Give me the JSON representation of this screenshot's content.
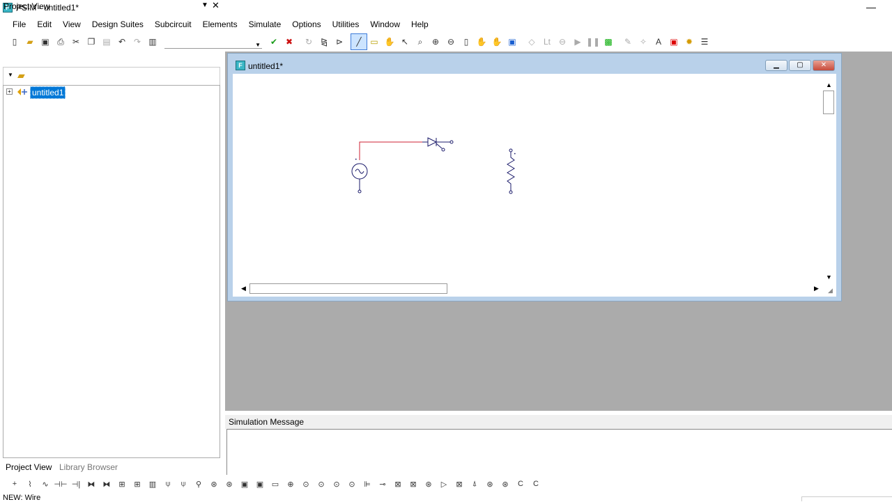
{
  "app": {
    "title": "PSIM - untitled1*",
    "icon_glyph": "F"
  },
  "menu": [
    "File",
    "Edit",
    "View",
    "Design Suites",
    "Subcircuit",
    "Elements",
    "Simulate",
    "Options",
    "Utilities",
    "Window",
    "Help"
  ],
  "project_view": {
    "title": "Project View",
    "tree_item": "untitled1",
    "tabs": [
      "Project View",
      "Library Browser"
    ]
  },
  "document": {
    "title": "untitled1*"
  },
  "simulation_message": {
    "title": "Simulation Message"
  },
  "status": {
    "text": "NEW: Wire"
  },
  "colors": {
    "wire": "#cc2233",
    "selection": "#0078d7",
    "workspace": "#ababab",
    "doc_frame": "#b9d1ea"
  }
}
